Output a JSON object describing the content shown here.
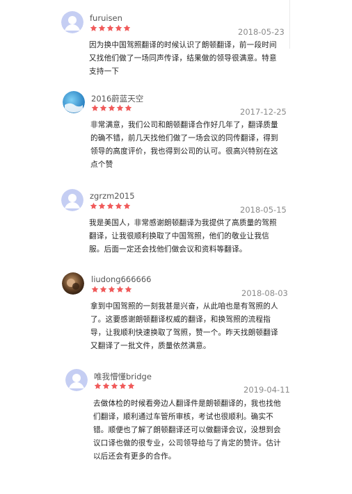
{
  "colors": {
    "star": "#f05a5a",
    "avatar_default": "#b9c4ee"
  },
  "reviews": [
    {
      "user": "furuisen",
      "rating": 5,
      "avatar": "default-avatar-icon",
      "date": "2018-05-23",
      "text": "因为换中国驾照翻译的时候认识了朗顿翻译，前一段时间又找他们做了一场同声传译，结果做的领导很满意。特意支持一下"
    },
    {
      "user": "2016蔚蓝天空",
      "rating": 5,
      "avatar": "blue-sky-avatar-icon",
      "date": "2017-12-25",
      "text": "非常满意，我们公司和朗顿翻译合作好几年了，翻译质量的确不错，前几天找他们做了一场会议的同传翻译，得到领导的高度评价，我也得到公司的认可。很高兴特别在这点个赞"
    },
    {
      "user": "zgrzm2015",
      "rating": 5,
      "avatar": "default-avatar-icon",
      "date": "2018-05-15",
      "text": "我是美国人，非常感谢朗顿翻译为我提供了高质量的驾照翻译，让我很顺利换取了中国驾照，他们的敬业让我信服。后面一定还会找他们做会议和资料等翻译。"
    },
    {
      "user": "liudong666666",
      "rating": 5,
      "avatar": "photo-avatar-icon",
      "date": "2018-08-03",
      "text": "拿到中国驾照的一刻我甚是兴奋，从此咱也是有驾照的人了。这要感谢朗顿翻译权威的翻译，和换驾照的流程指导，让我顺利快速换取了驾照，赞一个。昨天找朗顿翻译又翻译了一批文件，质量依然满意。"
    },
    {
      "user": "唯我懵懂bridge",
      "rating": 5,
      "avatar": "default-avatar-icon",
      "date": "2019-04-11",
      "text": "去做体检的时候看旁边人翻译件是朗顿翻译的，我也找他们翻译，顺利通过车管所审核，考试也很顺利。确实不错。顺便也了解了朗顿翻译还可以做翻译会议，没想到会议口译也做的很专业，公司领导给与了肯定的赞许。估计以后还会有更多的合作。"
    }
  ]
}
